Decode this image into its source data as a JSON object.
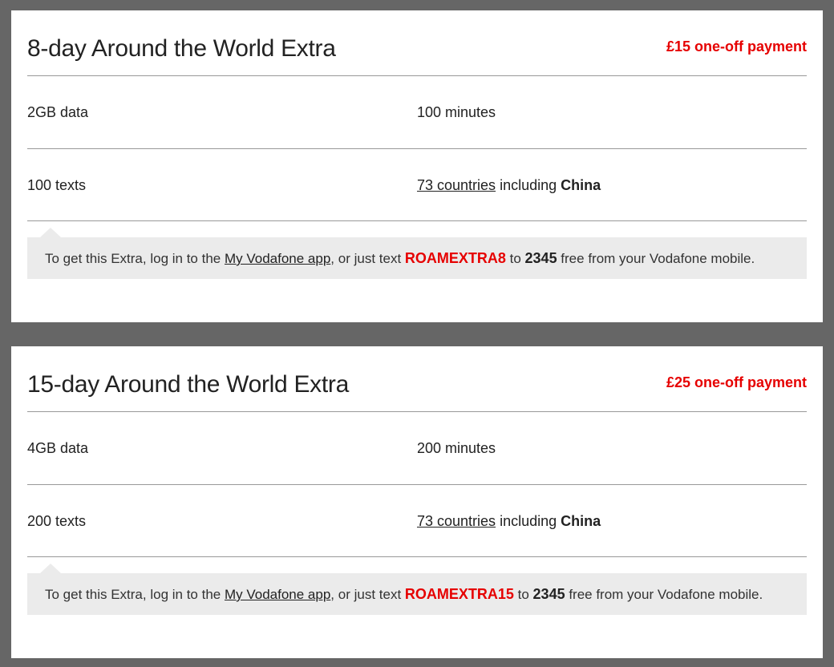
{
  "plans": [
    {
      "title": "8-day Around the World Extra",
      "price": "£15 one-off payment",
      "data": "2GB data",
      "minutes": "100 minutes",
      "texts": "100 texts",
      "countries_link": "73 countries",
      "including": " including ",
      "country": "China",
      "note": {
        "prefix": "To get this Extra, log in to the ",
        "app_link": "My Vodafone app",
        "middle": ", or just text ",
        "code": "ROAMEXTRA8",
        "to": " to ",
        "number": "2345",
        "suffix": " free from your Vodafone mobile."
      }
    },
    {
      "title": "15-day Around the World Extra",
      "price": "£25 one-off payment",
      "data": "4GB data",
      "minutes": "200 minutes",
      "texts": "200 texts",
      "countries_link": "73 countries",
      "including": " including ",
      "country": "China",
      "note": {
        "prefix": "To get this Extra, log in to the ",
        "app_link": "My Vodafone app",
        "middle": ", or just text ",
        "code": "ROAMEXTRA15",
        "to": " to ",
        "number": "2345",
        "suffix": " free from your Vodafone mobile."
      }
    }
  ],
  "colors": {
    "accent": "#e60000",
    "background": "#666666",
    "note_bg": "#ebebeb"
  }
}
